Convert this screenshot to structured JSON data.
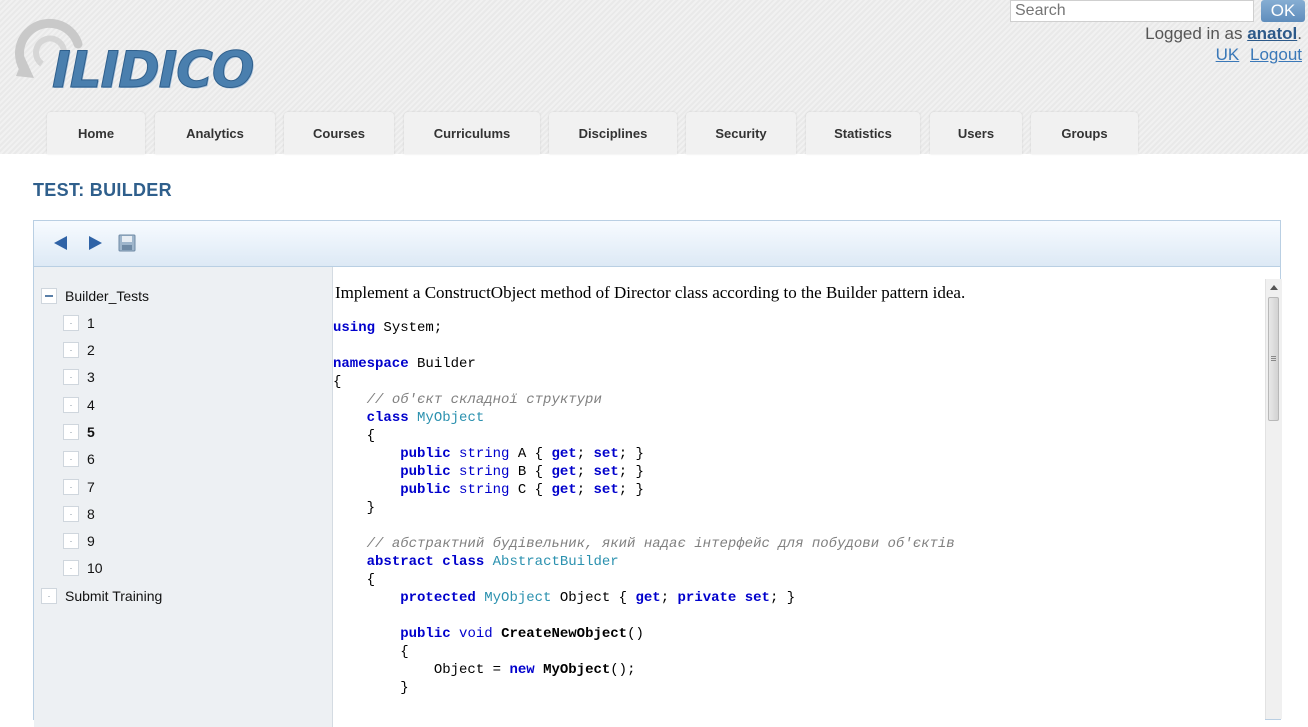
{
  "header": {
    "logo_text": "ILIDICO",
    "search": {
      "placeholder": "Search",
      "value": ""
    },
    "ok_label": "OK",
    "logged_in_prefix": "Logged in as ",
    "username": "anatol",
    "logged_in_suffix": ".",
    "language_link": "UK",
    "logout_link": "Logout"
  },
  "nav": {
    "tabs": [
      "Home",
      "Analytics",
      "Courses",
      "Curriculums",
      "Disciplines",
      "Security",
      "Statistics",
      "Users",
      "Groups"
    ]
  },
  "page": {
    "title": "TEST: BUILDER"
  },
  "toolbar": {
    "icons": [
      "back-arrow-icon",
      "forward-arrow-icon",
      "save-icon"
    ]
  },
  "tree": {
    "root": "Builder_Tests",
    "items": [
      "1",
      "2",
      "3",
      "4",
      "5",
      "6",
      "7",
      "8",
      "9",
      "10"
    ],
    "selected_item": "5",
    "footer_item": "Submit Training"
  },
  "question": {
    "text": "Implement a ConstructObject method of Director class according to the Builder pattern idea.",
    "code_lines": [
      "using System;",
      "",
      "namespace Builder",
      "{",
      "    // об'єкт складної структури",
      "    class MyObject",
      "    {",
      "        public string A { get; set; }",
      "        public string B { get; set; }",
      "        public string C { get; set; }",
      "    }",
      "",
      "    // абстрактний будівельник, який надає інтерфейс для побудови об'єктів",
      "    abstract class AbstractBuilder",
      "    {",
      "        protected MyObject Object { get; private set; }",
      "",
      "        public void CreateNewObject()",
      "        {",
      "            Object = new MyObject();",
      "        }"
    ]
  },
  "colors": {
    "title": "#2f5f8c",
    "keyword": "#0000cc",
    "type": "#2b91af",
    "comment": "#808080",
    "tree_background": "#edf0f3"
  }
}
